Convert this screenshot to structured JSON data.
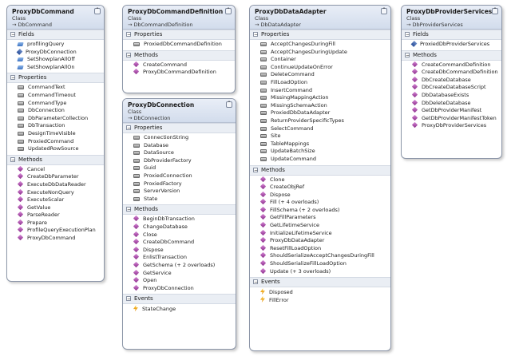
{
  "classes": {
    "cmd": {
      "name": "ProxyDbCommand",
      "kind": "Class",
      "base": "→ DbCommand",
      "sections": [
        {
          "title": "Fields",
          "items": [
            {
              "icon": "field-icon",
              "label": "profilingQuery"
            },
            {
              "icon": "static-field-icon",
              "label": "ProxyDbConnection"
            },
            {
              "icon": "field-icon",
              "label": "SetShowplanAllOff"
            },
            {
              "icon": "field-icon",
              "label": "SetShowplanAllOn"
            }
          ]
        },
        {
          "title": "Properties",
          "items": [
            {
              "icon": "property-icon",
              "label": "CommandText"
            },
            {
              "icon": "property-icon",
              "label": "CommandTimeout"
            },
            {
              "icon": "property-icon",
              "label": "CommandType"
            },
            {
              "icon": "property-icon",
              "label": "DbConnection"
            },
            {
              "icon": "property-icon",
              "label": "DbParameterCollection"
            },
            {
              "icon": "property-icon",
              "label": "DbTransaction"
            },
            {
              "icon": "property-icon",
              "label": "DesignTimeVisible"
            },
            {
              "icon": "property-icon",
              "label": "ProxiedCommand"
            },
            {
              "icon": "property-icon",
              "label": "UpdatedRowSource"
            }
          ]
        },
        {
          "title": "Methods",
          "items": [
            {
              "icon": "method-icon",
              "label": "Cancel"
            },
            {
              "icon": "method-icon",
              "label": "CreateDbParameter"
            },
            {
              "icon": "method-icon",
              "label": "ExecuteDbDataReader"
            },
            {
              "icon": "method-icon",
              "label": "ExecuteNonQuery"
            },
            {
              "icon": "method-icon",
              "label": "ExecuteScalar"
            },
            {
              "icon": "method-icon",
              "label": "GetValue"
            },
            {
              "icon": "method-icon",
              "label": "ParseReader"
            },
            {
              "icon": "method-icon",
              "label": "Prepare"
            },
            {
              "icon": "method-icon",
              "label": "ProfileQueryExecutionPlan"
            },
            {
              "icon": "method-icon",
              "label": "ProxyDbCommand"
            }
          ]
        }
      ]
    },
    "def": {
      "name": "ProxyDbCommandDefinition",
      "kind": "Class",
      "base": "→ DbCommandDefinition",
      "sections": [
        {
          "title": "Properties",
          "items": [
            {
              "icon": "property-icon",
              "label": "ProxiedDbCommandDefinition"
            }
          ]
        },
        {
          "title": "Methods",
          "items": [
            {
              "icon": "method-icon",
              "label": "CreateCommand"
            },
            {
              "icon": "method-icon",
              "label": "ProxyDbCommandDefinition"
            }
          ]
        }
      ]
    },
    "conn": {
      "name": "ProxyDbConnection",
      "kind": "Class",
      "base": "→ DbConnection",
      "sections": [
        {
          "title": "Properties",
          "items": [
            {
              "icon": "property-icon",
              "label": "ConnectionString"
            },
            {
              "icon": "property-icon",
              "label": "Database"
            },
            {
              "icon": "property-icon",
              "label": "DataSource"
            },
            {
              "icon": "property-icon",
              "label": "DbProviderFactory"
            },
            {
              "icon": "property-icon",
              "label": "Guid"
            },
            {
              "icon": "property-icon",
              "label": "ProxiedConnection"
            },
            {
              "icon": "property-icon",
              "label": "ProxiedFactory"
            },
            {
              "icon": "property-icon",
              "label": "ServerVersion"
            },
            {
              "icon": "property-icon",
              "label": "State"
            }
          ]
        },
        {
          "title": "Methods",
          "items": [
            {
              "icon": "method-icon",
              "label": "BeginDbTransaction"
            },
            {
              "icon": "method-icon",
              "label": "ChangeDatabase"
            },
            {
              "icon": "method-icon",
              "label": "Close"
            },
            {
              "icon": "method-icon",
              "label": "CreateDbCommand"
            },
            {
              "icon": "method-icon",
              "label": "Dispose"
            },
            {
              "icon": "method-icon",
              "label": "EnlistTransaction"
            },
            {
              "icon": "method-icon",
              "label": "GetSchema (+ 2 overloads)"
            },
            {
              "icon": "method-icon",
              "label": "GetService"
            },
            {
              "icon": "method-icon",
              "label": "Open"
            },
            {
              "icon": "method-icon",
              "label": "ProxyDbConnection"
            }
          ]
        },
        {
          "title": "Events",
          "items": [
            {
              "icon": "event-icon",
              "label": "StateChange"
            }
          ]
        }
      ]
    },
    "adapter": {
      "name": "ProxyDbDataAdapter",
      "kind": "Class",
      "base": "→ DbDataAdapter",
      "sections": [
        {
          "title": "Properties",
          "items": [
            {
              "icon": "property-icon",
              "label": "AcceptChangesDuringFill"
            },
            {
              "icon": "property-icon",
              "label": "AcceptChangesDuringUpdate"
            },
            {
              "icon": "property-icon",
              "label": "Container"
            },
            {
              "icon": "property-icon",
              "label": "ContinueUpdateOnError"
            },
            {
              "icon": "property-icon",
              "label": "DeleteCommand"
            },
            {
              "icon": "property-icon",
              "label": "FillLoadOption"
            },
            {
              "icon": "property-icon",
              "label": "InsertCommand"
            },
            {
              "icon": "property-icon",
              "label": "MissingMappingAction"
            },
            {
              "icon": "property-icon",
              "label": "MissingSchemaAction"
            },
            {
              "icon": "property-icon",
              "label": "ProxiedDbDataAdapter"
            },
            {
              "icon": "property-icon",
              "label": "ReturnProviderSpecificTypes"
            },
            {
              "icon": "property-icon",
              "label": "SelectCommand"
            },
            {
              "icon": "property-icon",
              "label": "Site"
            },
            {
              "icon": "property-icon",
              "label": "TableMappings"
            },
            {
              "icon": "property-icon",
              "label": "UpdateBatchSize"
            },
            {
              "icon": "property-icon",
              "label": "UpdateCommand"
            }
          ]
        },
        {
          "title": "Methods",
          "items": [
            {
              "icon": "method-icon",
              "label": "Clone"
            },
            {
              "icon": "method-icon",
              "label": "CreateObjRef"
            },
            {
              "icon": "method-icon",
              "label": "Dispose"
            },
            {
              "icon": "method-icon",
              "label": "Fill (+ 4 overloads)"
            },
            {
              "icon": "method-icon",
              "label": "FillSchema (+ 2 overloads)"
            },
            {
              "icon": "method-icon",
              "label": "GetFillParameters"
            },
            {
              "icon": "method-icon",
              "label": "GetLifetimeService"
            },
            {
              "icon": "method-icon",
              "label": "InitializeLifetimeService"
            },
            {
              "icon": "method-icon",
              "label": "ProxyDbDataAdapter"
            },
            {
              "icon": "method-icon",
              "label": "ResetFillLoadOption"
            },
            {
              "icon": "method-icon",
              "label": "ShouldSerializeAcceptChangesDuringFill"
            },
            {
              "icon": "method-icon",
              "label": "ShouldSerializeFillLoadOption"
            },
            {
              "icon": "method-icon",
              "label": "Update (+ 3 overloads)"
            }
          ]
        },
        {
          "title": "Events",
          "items": [
            {
              "icon": "event-icon",
              "label": "Disposed"
            },
            {
              "icon": "event-icon",
              "label": "FillError"
            }
          ]
        }
      ]
    },
    "services": {
      "name": "ProxyDbProviderServices",
      "kind": "Class",
      "base": "→ DbProviderServices",
      "sections": [
        {
          "title": "Fields",
          "items": [
            {
              "icon": "static-field-icon",
              "label": "ProxiedDbProviderServices"
            }
          ]
        },
        {
          "title": "Methods",
          "items": [
            {
              "icon": "method-icon",
              "label": "CreateCommandDefinition"
            },
            {
              "icon": "method-icon",
              "label": "CreateDbCommandDefinition"
            },
            {
              "icon": "method-icon",
              "label": "DbCreateDatabase"
            },
            {
              "icon": "method-icon",
              "label": "DbCreateDatabaseScript"
            },
            {
              "icon": "method-icon",
              "label": "DbDatabaseExists"
            },
            {
              "icon": "method-icon",
              "label": "DbDeleteDatabase"
            },
            {
              "icon": "method-icon",
              "label": "GetDbProviderManifest"
            },
            {
              "icon": "method-icon",
              "label": "GetDbProviderManifestToken"
            },
            {
              "icon": "method-icon",
              "label": "ProxyDbProviderServices"
            }
          ]
        }
      ]
    }
  }
}
